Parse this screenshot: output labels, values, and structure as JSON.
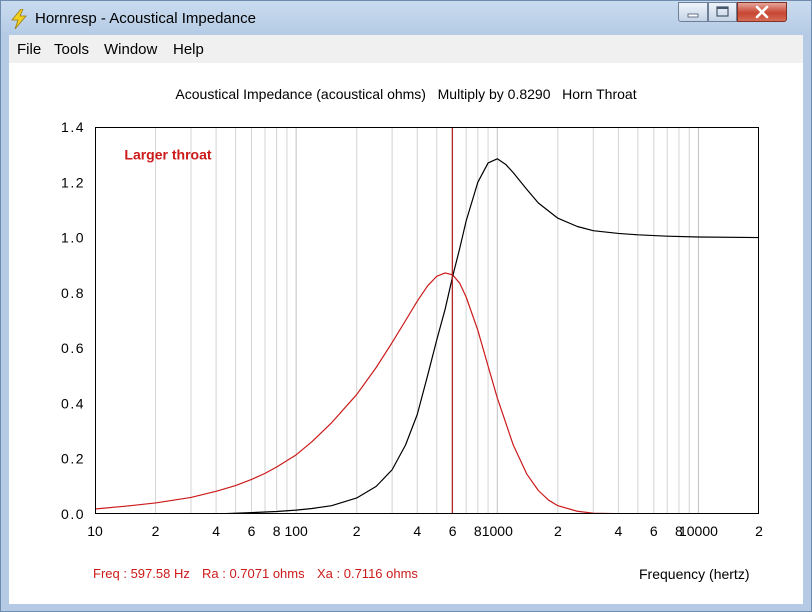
{
  "window": {
    "title": "Hornresp - Acoustical Impedance",
    "controls": {
      "minimize": "minimize",
      "maximize": "maximize",
      "close": "close"
    }
  },
  "menu": [
    {
      "label": "File"
    },
    {
      "label": "Tools"
    },
    {
      "label": "Window"
    },
    {
      "label": "Help"
    }
  ],
  "readout": {
    "freq": "Freq : 597.58 Hz",
    "ra": "Ra : 0.7071 ohms",
    "xa": "Xa : 0.7116 ohms"
  },
  "colors": {
    "ra_curve": "#cc1a1a",
    "xa_curve": "#000000",
    "cursor": "#b01818",
    "grid": "#d4d4d4",
    "annotation": "#cc1a1a"
  },
  "icons": {
    "app": "lightning-icon"
  },
  "chart_data": {
    "type": "line",
    "title": "Acoustical Impedance (acoustical ohms)   Multiply by 0.8290   Horn Throat",
    "xlabel": "Frequency (hertz)",
    "ylabel": "",
    "xscale": "log",
    "xlim": [
      10,
      20000
    ],
    "ylim": [
      0,
      1.4
    ],
    "grid": true,
    "y_ticks": [
      {
        "value": 0.0,
        "label": "0.0"
      },
      {
        "value": 0.2,
        "label": "0.2"
      },
      {
        "value": 0.4,
        "label": "0.4"
      },
      {
        "value": 0.6,
        "label": "0.6"
      },
      {
        "value": 0.8,
        "label": "0.8"
      },
      {
        "value": 1.0,
        "label": "1.0"
      },
      {
        "value": 1.2,
        "label": "1.2"
      },
      {
        "value": 1.4,
        "label": "1.4"
      }
    ],
    "x_ticks": [
      {
        "value": 10,
        "label": "10"
      },
      {
        "value": 20,
        "label": "2"
      },
      {
        "value": 40,
        "label": "4"
      },
      {
        "value": 60,
        "label": "6"
      },
      {
        "value": 80,
        "label": "8"
      },
      {
        "value": 100,
        "label": "100"
      },
      {
        "value": 200,
        "label": "2"
      },
      {
        "value": 400,
        "label": "4"
      },
      {
        "value": 600,
        "label": "6"
      },
      {
        "value": 800,
        "label": "8"
      },
      {
        "value": 1000,
        "label": "1000"
      },
      {
        "value": 2000,
        "label": "2"
      },
      {
        "value": 4000,
        "label": "4"
      },
      {
        "value": 6000,
        "label": "6"
      },
      {
        "value": 8000,
        "label": "8"
      },
      {
        "value": 10000,
        "label": "10000"
      },
      {
        "value": 20000,
        "label": "2"
      }
    ],
    "cursor_x": 597.58,
    "annotation": {
      "text": "Larger throat",
      "x": 14,
      "y": 1.3
    },
    "series": [
      {
        "key": "ra",
        "points": [
          [
            10,
            0.018
          ],
          [
            15,
            0.03
          ],
          [
            20,
            0.04
          ],
          [
            30,
            0.06
          ],
          [
            40,
            0.082
          ],
          [
            50,
            0.103
          ],
          [
            60,
            0.125
          ],
          [
            70,
            0.147
          ],
          [
            80,
            0.17
          ],
          [
            100,
            0.214
          ],
          [
            120,
            0.262
          ],
          [
            150,
            0.33
          ],
          [
            200,
            0.432
          ],
          [
            250,
            0.53
          ],
          [
            300,
            0.62
          ],
          [
            350,
            0.7
          ],
          [
            400,
            0.77
          ],
          [
            450,
            0.825
          ],
          [
            500,
            0.86
          ],
          [
            550,
            0.872
          ],
          [
            600,
            0.865
          ],
          [
            650,
            0.835
          ],
          [
            700,
            0.785
          ],
          [
            800,
            0.665
          ],
          [
            900,
            0.535
          ],
          [
            1000,
            0.42
          ],
          [
            1200,
            0.25
          ],
          [
            1400,
            0.145
          ],
          [
            1600,
            0.085
          ],
          [
            1800,
            0.05
          ],
          [
            2000,
            0.03
          ],
          [
            2500,
            0.01
          ],
          [
            3000,
            0.003
          ],
          [
            5000,
            0.0
          ],
          [
            20000,
            0.0
          ]
        ]
      },
      {
        "key": "xa",
        "points": [
          [
            40,
            0.0
          ],
          [
            50,
            0.003
          ],
          [
            60,
            0.005
          ],
          [
            80,
            0.009
          ],
          [
            100,
            0.014
          ],
          [
            120,
            0.02
          ],
          [
            150,
            0.03
          ],
          [
            200,
            0.058
          ],
          [
            250,
            0.1
          ],
          [
            300,
            0.16
          ],
          [
            350,
            0.25
          ],
          [
            400,
            0.36
          ],
          [
            450,
            0.5
          ],
          [
            500,
            0.63
          ],
          [
            550,
            0.74
          ],
          [
            600,
            0.86
          ],
          [
            650,
            0.96
          ],
          [
            700,
            1.06
          ],
          [
            800,
            1.2
          ],
          [
            900,
            1.27
          ],
          [
            1000,
            1.285
          ],
          [
            1100,
            1.265
          ],
          [
            1200,
            1.235
          ],
          [
            1400,
            1.175
          ],
          [
            1600,
            1.125
          ],
          [
            2000,
            1.07
          ],
          [
            2500,
            1.04
          ],
          [
            3000,
            1.025
          ],
          [
            4000,
            1.015
          ],
          [
            5000,
            1.01
          ],
          [
            7000,
            1.005
          ],
          [
            10000,
            1.002
          ],
          [
            20000,
            1.0
          ]
        ]
      }
    ]
  }
}
